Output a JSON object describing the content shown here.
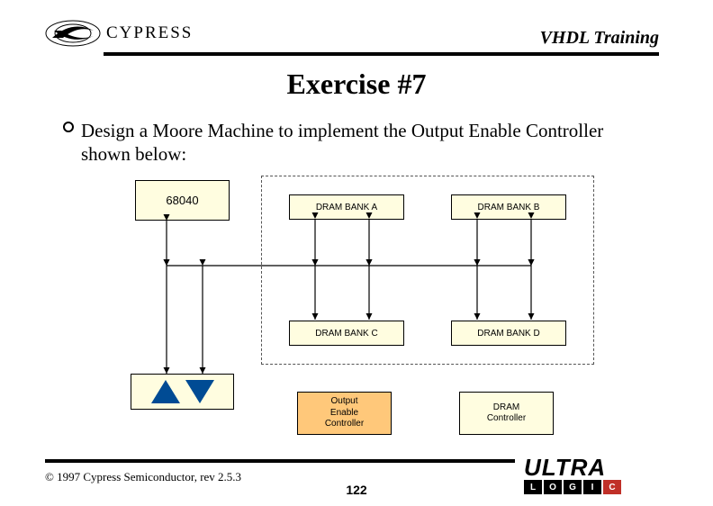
{
  "header": {
    "brand": "CYPRESS",
    "title": "VHDL Training"
  },
  "slide": {
    "title": "Exercise #7",
    "bullet": "Design a Moore Machine to implement the Output Enable Controller shown below:"
  },
  "diagram": {
    "cpu": "68040",
    "banks": {
      "a": "DRAM BANK A",
      "b": "DRAM BANK B",
      "c": "DRAM BANK C",
      "d": "DRAM BANK D"
    },
    "oec": {
      "l1": "Output",
      "l2": "Enable",
      "l3": "Controller"
    },
    "dramctl": {
      "l1": "DRAM",
      "l2": "Controller"
    }
  },
  "footer": {
    "copyright": "© 1997 Cypress Semiconductor, rev 2.5.3",
    "page": "122",
    "ultra": {
      "word": "ULTRA",
      "cells": [
        "L",
        "O",
        "G",
        "I",
        "C"
      ]
    }
  }
}
